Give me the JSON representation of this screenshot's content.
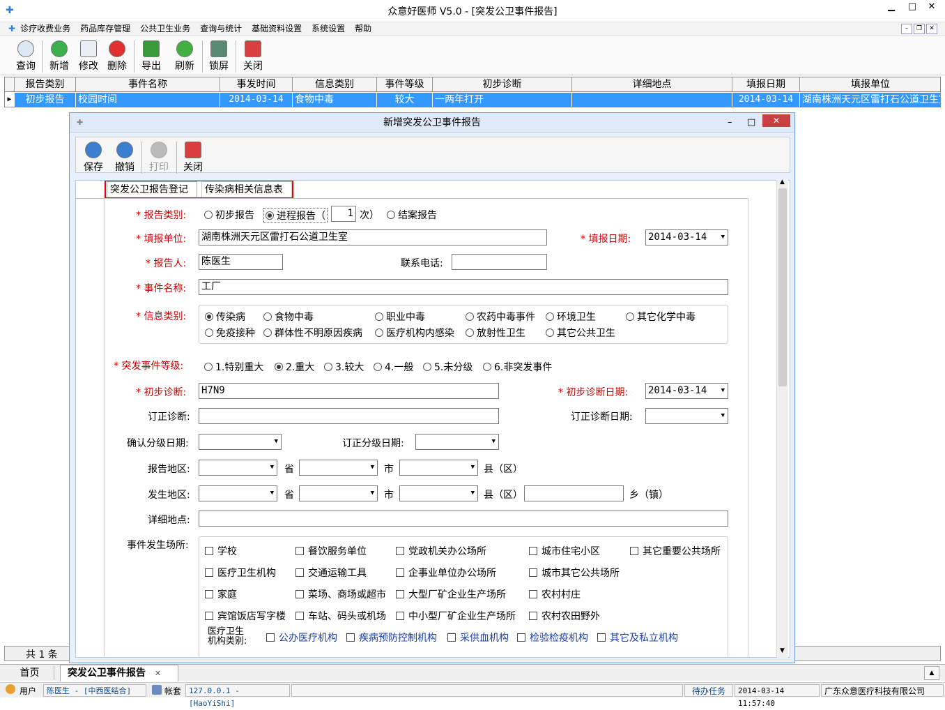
{
  "window": {
    "title": "众意好医师 V5.0 - [突发公卫事件报告]",
    "min": "▁",
    "max": "□",
    "close": "✕"
  },
  "menu": [
    "诊疗收费业务",
    "药品库存管理",
    "公共卫生业务",
    "查询与统计",
    "基础资料设置",
    "系统设置",
    "帮助"
  ],
  "mdi": {
    "min": "–",
    "restore": "❐",
    "close": "✕"
  },
  "toolbar": [
    "查询",
    "新增",
    "修改",
    "删除",
    "导出",
    "刷新",
    "锁屏",
    "关闭"
  ],
  "grid": {
    "headers": [
      "报告类别",
      "事件名称",
      "事发时间",
      "信息类别",
      "事件等级",
      "初步诊断",
      "详细地点",
      "填报日期",
      "填报单位"
    ],
    "row": [
      "初步报告",
      "校园时间",
      "2014-03-14",
      "食物中毒",
      "较大",
      "一两年打开",
      "",
      "2014-03-14",
      "湖南株洲天元区雷打石公道卫生室"
    ],
    "footer": "共 1 条"
  },
  "tabs": {
    "home": "首页",
    "current": "突发公卫事件报告",
    "close": "✕"
  },
  "status": {
    "user_label": "用户",
    "user": "陈医生 - [中西医结合]",
    "acct_label": "帐套",
    "acct": "127.0.0.1 - [HaoYiShi]",
    "todo": "待办任务",
    "time": "2014-03-14 11:57:40",
    "company": "广东众意医疗科技有限公司"
  },
  "dialog": {
    "title": "新增突发公卫事件报告",
    "tools": [
      "保存",
      "撤销",
      "打印",
      "关闭"
    ],
    "tabs": [
      "突发公卫报告登记",
      "传染病相关信息表"
    ],
    "report_type_label": "报告类别:",
    "report_types": [
      "初步报告",
      "进程报告（",
      "结案报告"
    ],
    "progress_count": "1",
    "progress_suffix": "次）",
    "unit_label": "填报单位:",
    "unit_value": "湖南株洲天元区雷打石公道卫生室",
    "date_label": "填报日期:",
    "date_value": "2014-03-14",
    "reporter_label": "报告人:",
    "reporter_value": "陈医生",
    "phone_label": "联系电话:",
    "event_name_label": "事件名称:",
    "event_name_value": "工厂",
    "info_label": "信息类别:",
    "info_opts": [
      "传染病",
      "食物中毒",
      "职业中毒",
      "农药中毒事件",
      "环境卫生",
      "其它化学中毒",
      "免疫接种",
      "群体性不明原因疾病",
      "医疗机构内感染",
      "放射性卫生",
      "其它公共卫生"
    ],
    "level_label": "突发事件等级:",
    "level_opts": [
      "1.特别重大",
      "2.重大",
      "3.较大",
      "4.一般",
      "5.未分级",
      "6.非突发事件"
    ],
    "diag_label": "初步诊断:",
    "diag_value": "H7N9",
    "diag_date_label": "初步诊断日期:",
    "diag_date_value": "2014-03-14",
    "rev_diag_label": "订正诊断:",
    "rev_diag_date_label": "订正诊断日期:",
    "confirm_level_label": "确认分级日期:",
    "rev_level_label": "订正分级日期:",
    "report_area_label": "报告地区:",
    "occur_area_label": "发生地区:",
    "province": "省",
    "city": "市",
    "county": "县（区）",
    "town": "乡（镇）",
    "address_label": "详细地点:",
    "place_label": "事件发生场所:",
    "places": [
      "学校",
      "餐饮服务单位",
      "党政机关办公场所",
      "城市住宅小区",
      "其它重要公共场所",
      "医疗卫生机构",
      "交通运输工具",
      "企事业单位办公场所",
      "城市其它公共场所",
      "家庭",
      "菜场、商场或超市",
      "大型厂矿企业生产场所",
      "农村村庄",
      "宾馆饭店写字楼",
      "车站、码头或机场",
      "中小型厂矿企业生产场所",
      "农村农田野外"
    ],
    "med_label_1": "医疗卫生",
    "med_label_2": "机构类别:",
    "med_opts": [
      "公办医疗机构",
      "疾病预防控制机构",
      "采供血机构",
      "检验检疫机构",
      "其它及私立机构"
    ]
  }
}
